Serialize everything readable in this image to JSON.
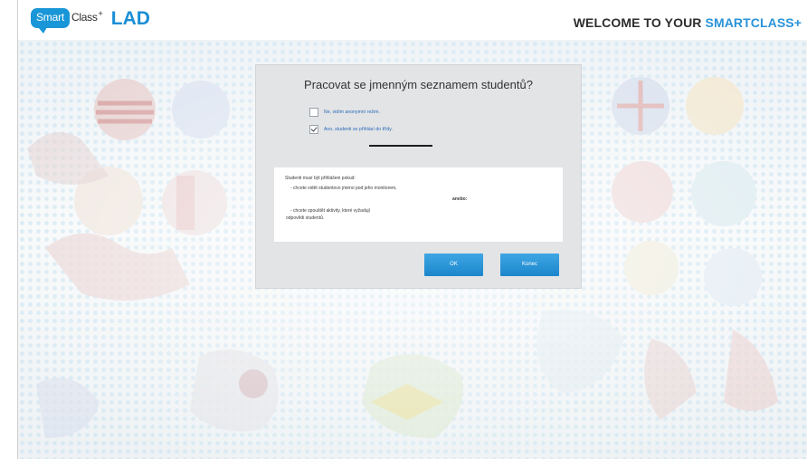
{
  "header": {
    "logo_smart": "Smart",
    "logo_class": "Class",
    "logo_plus": "+",
    "logo_lad": "LAD",
    "welcome_prefix": "WELCOME TO YOUR ",
    "welcome_accent": "SMARTCLASS+"
  },
  "dialog": {
    "title": "Pracovat se jmenným seznamem studentů?",
    "option1": "Ne, vidím anonymní režim.",
    "option1_checked": false,
    "option2": "Ano, studenti se přihlásí do třídy.",
    "option2_checked": true,
    "info": {
      "line1": "Studenti musí být přihlášeni pokud:",
      "line2": "- chcete vidět studentovo jméno pod jeho monitorem,",
      "line3": "anebo:",
      "line4": "- chcete spouštět aktivity, které vyžadují",
      "line5": "odpovědi studentů."
    },
    "ok_label": "OK",
    "cancel_label": "Konec"
  },
  "colors": {
    "brand_blue": "#1996d8",
    "button_blue": "#2a93d9",
    "dialog_bg": "#e3e4e6"
  }
}
